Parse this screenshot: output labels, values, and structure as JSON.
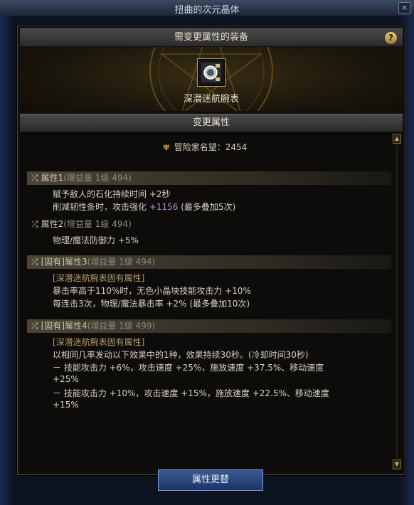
{
  "window": {
    "title": "扭曲的次元晶体",
    "close_label": "×"
  },
  "equip_section": {
    "header": "需变更属性的装备",
    "help_label": "?",
    "item_name": "深潜迷航腕表"
  },
  "attr_section": {
    "header": "变更属性",
    "renown_label": "冒险家名望：2454",
    "attributes": [
      {
        "title": "属性1",
        "sub": "(增益量 1级 494)",
        "lines": [
          {
            "text": "赋予敌人的石化持续时间 +2秒"
          },
          {
            "prefix": "削减韧性条时，攻击强化 ",
            "value": "+1156",
            "suffix": " (最多叠加5次)"
          }
        ]
      },
      {
        "title": "属性2",
        "sub": "(增益量 1级 494)",
        "lines": [
          {
            "text": "物理/魔法防御力 +5%"
          }
        ]
      },
      {
        "title": "[固有]属性3",
        "sub": "(增益量 1级 494)",
        "lines": [
          {
            "text": "[深潜迷航腕表固有属性]"
          },
          {
            "text": "暴击率高于110%时，无色小晶块技能攻击力 +10%"
          },
          {
            "text": "每连击3次，物理/魔法暴击率 +2% (最多叠加10次)"
          }
        ]
      },
      {
        "title": "[固有]属性4",
        "sub": "(增益量 1级 499)",
        "lines": [
          {
            "text": "[深潜迷航腕表固有属性]"
          },
          {
            "text": "以相同几率发动以下效果中的1种，效果持续30秒。(冷却时间30秒)"
          },
          {
            "text": "－ 技能攻击力 +6%，攻击速度 +25%，施放速度 +37.5%、移动速度"
          },
          {
            "text": "+25%"
          },
          {
            "text": "－ 技能攻击力 +10%，攻击速度 +15%，施放速度 +22.5%、移动速度"
          },
          {
            "text": "+15%"
          }
        ]
      }
    ]
  },
  "action_button": "属性更替",
  "icons": {
    "close": "close-icon",
    "help": "help-icon",
    "renown": "crest-icon",
    "shuffle": "shuffle-icon",
    "item": "wristwatch-icon"
  },
  "colors": {
    "highlight_value": "#b28ddb",
    "accent_gold": "#d6a23a",
    "button_blue": "#2a4a85"
  }
}
